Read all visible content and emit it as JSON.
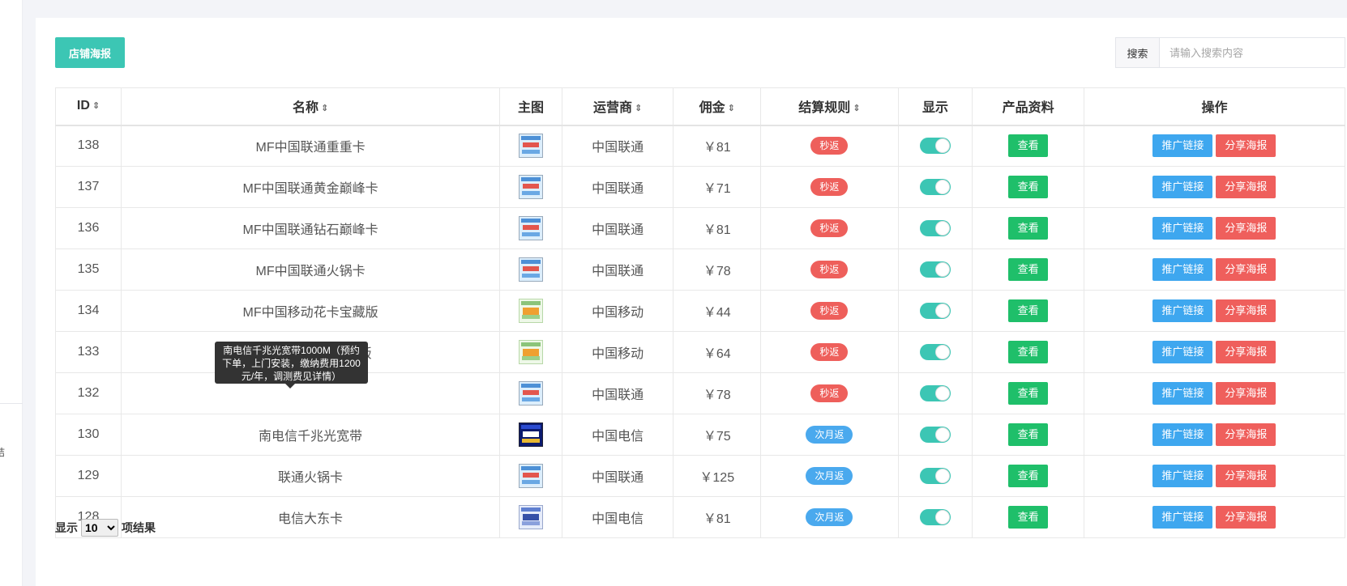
{
  "toolbar": {
    "poster_button": "店铺海报"
  },
  "search": {
    "label": "搜索",
    "placeholder": "请输入搜索内容",
    "value": ""
  },
  "table": {
    "columns": [
      "ID",
      "名称",
      "主图",
      "运营商",
      "佣金",
      "结算规则",
      "显示",
      "产品资料",
      "操作"
    ],
    "view_label": "查看",
    "promo_label": "推广链接",
    "share_label": "分享海报",
    "rows": [
      {
        "id": "138",
        "name": "MF中国联通重重卡",
        "thumb": "unicom",
        "operator": "中国联通",
        "commission": "￥81",
        "rule": "秒返",
        "rule_color": "red"
      },
      {
        "id": "137",
        "name": "MF中国联通黄金巅峰卡",
        "thumb": "unicom",
        "operator": "中国联通",
        "commission": "￥71",
        "rule": "秒返",
        "rule_color": "red"
      },
      {
        "id": "136",
        "name": "MF中国联通钻石巅峰卡",
        "thumb": "unicom",
        "operator": "中国联通",
        "commission": "￥81",
        "rule": "秒返",
        "rule_color": "red"
      },
      {
        "id": "135",
        "name": "MF中国联通火锅卡",
        "thumb": "unicom",
        "operator": "中国联通",
        "commission": "￥78",
        "rule": "秒返",
        "rule_color": "red"
      },
      {
        "id": "134",
        "name": "MF中国移动花卡宝藏版",
        "thumb": "mobile",
        "operator": "中国移动",
        "commission": "￥44",
        "rule": "秒返",
        "rule_color": "red"
      },
      {
        "id": "133",
        "name": "MF移动花卡大宝藏版",
        "thumb": "mobile",
        "operator": "中国移动",
        "commission": "￥64",
        "rule": "秒返",
        "rule_color": "red"
      },
      {
        "id": "132",
        "name": "",
        "thumb": "unicom",
        "operator": "中国联通",
        "commission": "￥78",
        "rule": "秒返",
        "rule_color": "red"
      },
      {
        "id": "130",
        "name": "南电信千兆光宽带",
        "thumb": "broadband",
        "operator": "中国电信",
        "commission": "￥75",
        "rule": "次月返",
        "rule_color": "blue"
      },
      {
        "id": "129",
        "name": "联通火锅卡",
        "thumb": "unicom",
        "operator": "中国联通",
        "commission": "￥125",
        "rule": "次月返",
        "rule_color": "blue"
      },
      {
        "id": "128",
        "name": "电信大东卡",
        "thumb": "telecom",
        "operator": "中国电信",
        "commission": "￥81",
        "rule": "次月返",
        "rule_color": "blue"
      }
    ]
  },
  "tooltip": {
    "text": "南电信千兆光宽带1000M（预约下单，上门安装，缴纳费用1200元/年，调测费见详情）"
  },
  "pagination": {
    "prefix": "显示",
    "page_size": "10",
    "suffix": "项结果"
  },
  "colors": {
    "accent": "#3cc6b4",
    "view": "#1fbf6a",
    "promo": "#3ea7ef",
    "share": "#ef5f5c",
    "badge_red": "#ee5f5b",
    "badge_blue": "#4aa9ee"
  }
}
